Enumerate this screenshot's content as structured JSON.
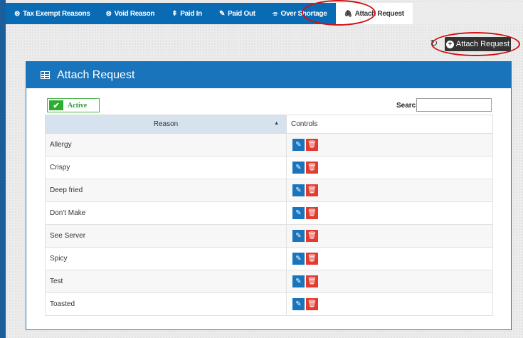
{
  "tabs": [
    {
      "label": "Tax Exempt Reasons",
      "icon": "⊗"
    },
    {
      "label": "Void Reason",
      "icon": "⊗"
    },
    {
      "label": "Paid In",
      "icon": "⇞"
    },
    {
      "label": "Paid Out",
      "icon": "✎"
    },
    {
      "label": "Over Shortage",
      "icon": "⌯"
    },
    {
      "label": "Attach Request",
      "icon": "🖇"
    }
  ],
  "toolbar": {
    "attach_button_label": "Attach Request"
  },
  "panel": {
    "title": "Attach Request",
    "active_label": "Active",
    "search_label": "Search",
    "search_value": "",
    "columns": {
      "reason": "Reason",
      "controls": "Controls"
    },
    "rows": [
      {
        "reason": "Allergy"
      },
      {
        "reason": "Crispy"
      },
      {
        "reason": "Deep fried"
      },
      {
        "reason": "Don't Make"
      },
      {
        "reason": "See Server"
      },
      {
        "reason": "Spicy"
      },
      {
        "reason": "Test"
      },
      {
        "reason": "Toasted"
      }
    ]
  },
  "colors": {
    "tabbar": "#0a6bb5",
    "panel_header": "#1a74bb",
    "edit_button": "#1a74bb",
    "delete_button": "#e23b2f",
    "active_green": "#2eae2e",
    "annotation": "#d01010"
  }
}
